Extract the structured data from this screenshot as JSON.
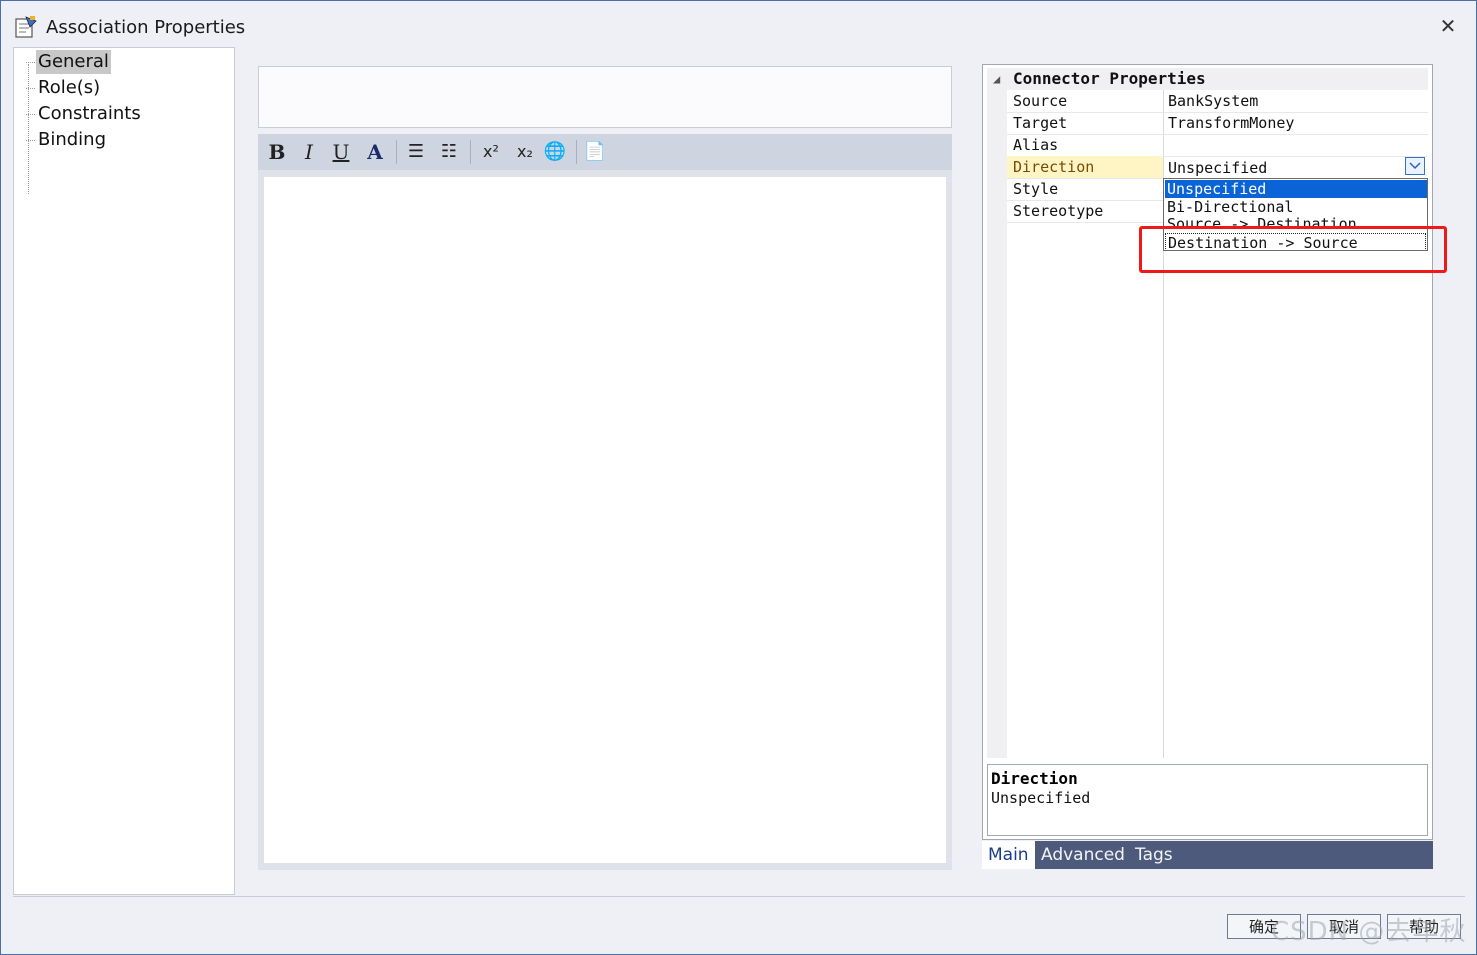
{
  "window": {
    "title": "Association Properties",
    "close_glyph": "✕"
  },
  "tree": {
    "items": [
      "General",
      "Role(s)",
      "Constraints",
      "Binding"
    ],
    "selected": "General"
  },
  "toolbar": {
    "buttons": [
      {
        "name": "bold-button",
        "glyph": "B"
      },
      {
        "name": "italic-button",
        "glyph": "I"
      },
      {
        "name": "underline-button",
        "glyph": "U"
      },
      {
        "name": "font-color-button",
        "glyph": "A"
      },
      {
        "name": "bullet-list-button",
        "glyph": "☰"
      },
      {
        "name": "numbered-list-button",
        "glyph": "☷"
      },
      {
        "name": "superscript-button",
        "glyph": "x²"
      },
      {
        "name": "subscript-button",
        "glyph": "x₂"
      },
      {
        "name": "hyperlink-button",
        "glyph": "🌐"
      },
      {
        "name": "document-button",
        "glyph": "📄"
      }
    ]
  },
  "properties": {
    "section_title": "Connector Properties",
    "rows": [
      {
        "name": "Source",
        "value": "BankSystem"
      },
      {
        "name": "Target",
        "value": "TransformMoney"
      },
      {
        "name": "Alias",
        "value": ""
      },
      {
        "name": "Direction",
        "value": "Unspecified"
      },
      {
        "name": "Style",
        "value": ""
      },
      {
        "name": "Stereotype",
        "value": ""
      }
    ],
    "direction_options": [
      "Unspecified",
      "Bi-Directional",
      "Source -> Destination",
      "Destination -> Source"
    ],
    "direction_selected": "Unspecified",
    "direction_focused": "Destination -> Source"
  },
  "description": {
    "title": "Direction",
    "value": "Unspecified"
  },
  "tabs": [
    "Main",
    "Advanced",
    "Tags"
  ],
  "active_tab": "Main",
  "buttons": {
    "ok": "确定",
    "cancel": "取消",
    "help": "帮助"
  },
  "watermark": "CSDN @去年秋天一",
  "colors": {
    "accent": "#0a64d8",
    "highlight": "#f01818",
    "tabs_bar": "#4d5a7b"
  }
}
